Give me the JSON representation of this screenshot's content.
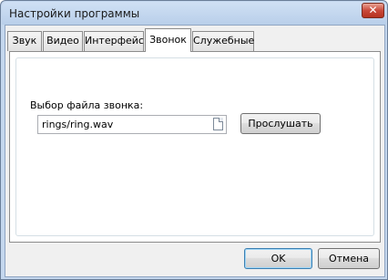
{
  "window": {
    "title": "Настройки программы",
    "close_glyph": "✕"
  },
  "tabs": [
    {
      "label": "Звук",
      "active": false
    },
    {
      "label": "Видео",
      "active": false
    },
    {
      "label": "Интерфейс",
      "active": false
    },
    {
      "label": "Звонок",
      "active": true
    },
    {
      "label": "Служебные",
      "active": false
    }
  ],
  "ring_tab": {
    "file_label": "Выбор файла звонка:",
    "file_value": "rings/ring.wav",
    "listen_button": "Прослушать"
  },
  "footer": {
    "ok_label": "OK",
    "cancel_label": "Отмена"
  },
  "colors": {
    "frame": "#c4d7ee",
    "default_button_border": "#3c7fb1"
  }
}
